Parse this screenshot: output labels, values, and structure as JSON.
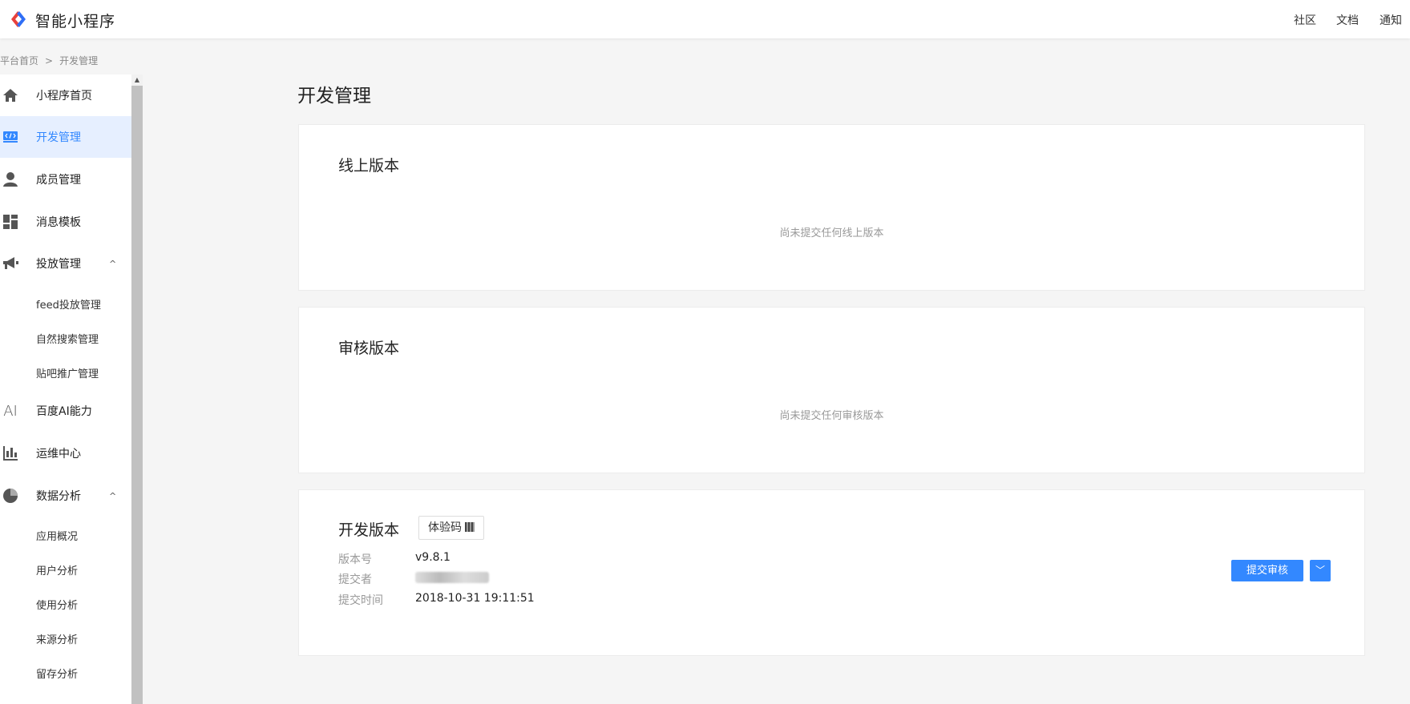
{
  "header": {
    "app_title": "智能小程序",
    "nav": [
      "社区",
      "文档",
      "通知"
    ]
  },
  "breadcrumb": {
    "items": [
      "平台首页",
      "开发管理"
    ],
    "separator": ">"
  },
  "sidebar": {
    "items": [
      {
        "label": "小程序首页",
        "icon": "home-icon"
      },
      {
        "label": "开发管理",
        "icon": "code-icon",
        "active": true
      },
      {
        "label": "成员管理",
        "icon": "user-icon"
      },
      {
        "label": "消息模板",
        "icon": "template-icon"
      },
      {
        "label": "投放管理",
        "icon": "megaphone-icon",
        "expanded": true
      },
      {
        "label": "百度AI能力",
        "icon": "ai-icon"
      },
      {
        "label": "运维中心",
        "icon": "bar-chart-icon"
      },
      {
        "label": "数据分析",
        "icon": "pie-chart-icon",
        "expanded": true
      }
    ],
    "sub_items_launch": [
      "feed投放管理",
      "自然搜索管理",
      "贴吧推广管理"
    ],
    "sub_items_data": [
      "应用概况",
      "用户分析",
      "使用分析",
      "来源分析",
      "留存分析"
    ],
    "chevron": "^",
    "ai_glyph": "AI"
  },
  "main": {
    "page_title": "开发管理",
    "online": {
      "title": "线上版本",
      "empty": "尚未提交任何线上版本"
    },
    "review": {
      "title": "审核版本",
      "empty": "尚未提交任何审核版本"
    },
    "dev": {
      "title": "开发版本",
      "qr_button": "体验码",
      "rows": [
        {
          "label": "版本号",
          "value": "v9.8.1"
        },
        {
          "label": "提交者",
          "value": ""
        },
        {
          "label": "提交时间",
          "value": "2018-10-31 19:11:51"
        }
      ],
      "submit_button": "提交审核",
      "dropdown_glyph": "﹀"
    }
  },
  "colors": {
    "accent": "#3388ff",
    "active_bg": "#e6efff"
  }
}
